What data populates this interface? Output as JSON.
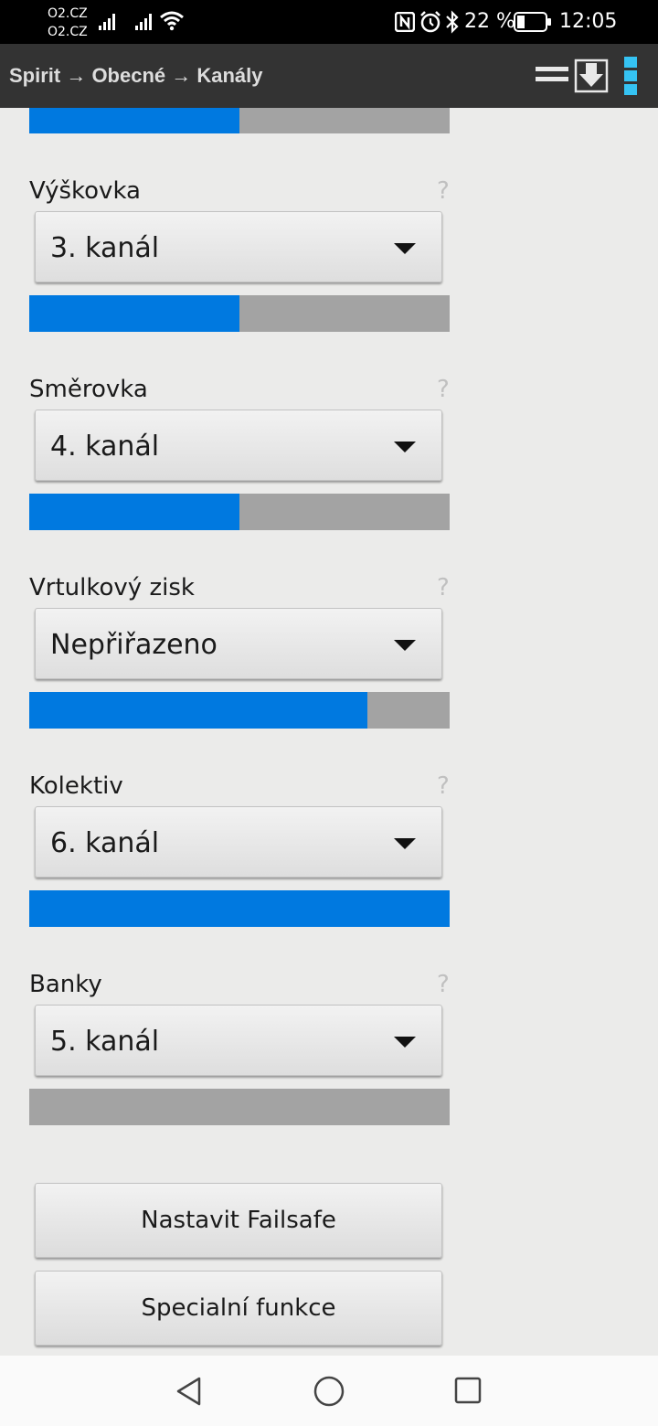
{
  "status_bar": {
    "carrier_1": "O2.CZ",
    "carrier_2": "O2.CZ",
    "battery": "22 %",
    "time": "12:05",
    "icons": [
      "signal-icon",
      "signal-icon",
      "wifi-icon",
      "nfc-icon",
      "alarm-icon",
      "bluetooth-icon",
      "battery-icon"
    ]
  },
  "app_bar": {
    "breadcrumb": "Spirit → Obecné → Kanály",
    "icons": [
      "menu-icon",
      "download-icon",
      "overflow-menu-icon"
    ]
  },
  "channels": [
    {
      "label": "Výškovka",
      "value": "3. kanál",
      "help": "?",
      "level": 0.5
    },
    {
      "label": "Směrovka",
      "value": "4. kanál",
      "help": "?",
      "level": 0.5
    },
    {
      "label": "Vrtulkový zisk",
      "value": "Nepřiřazeno",
      "help": "?",
      "level": 0.805
    },
    {
      "label": "Kolektiv",
      "value": "6. kanál",
      "help": "?",
      "level": 1.0
    },
    {
      "label": "Banky",
      "value": "5. kanál",
      "help": "?",
      "level": 0.0
    }
  ],
  "top_bar_level": 0.5,
  "buttons": {
    "failsafe": "Nastavit Failsafe",
    "special": "Specialní funkce"
  },
  "colors": {
    "accent": "#0079e0",
    "bar_track": "#a3a3a3",
    "app_bar": "#333333",
    "background": "#ebebea"
  }
}
